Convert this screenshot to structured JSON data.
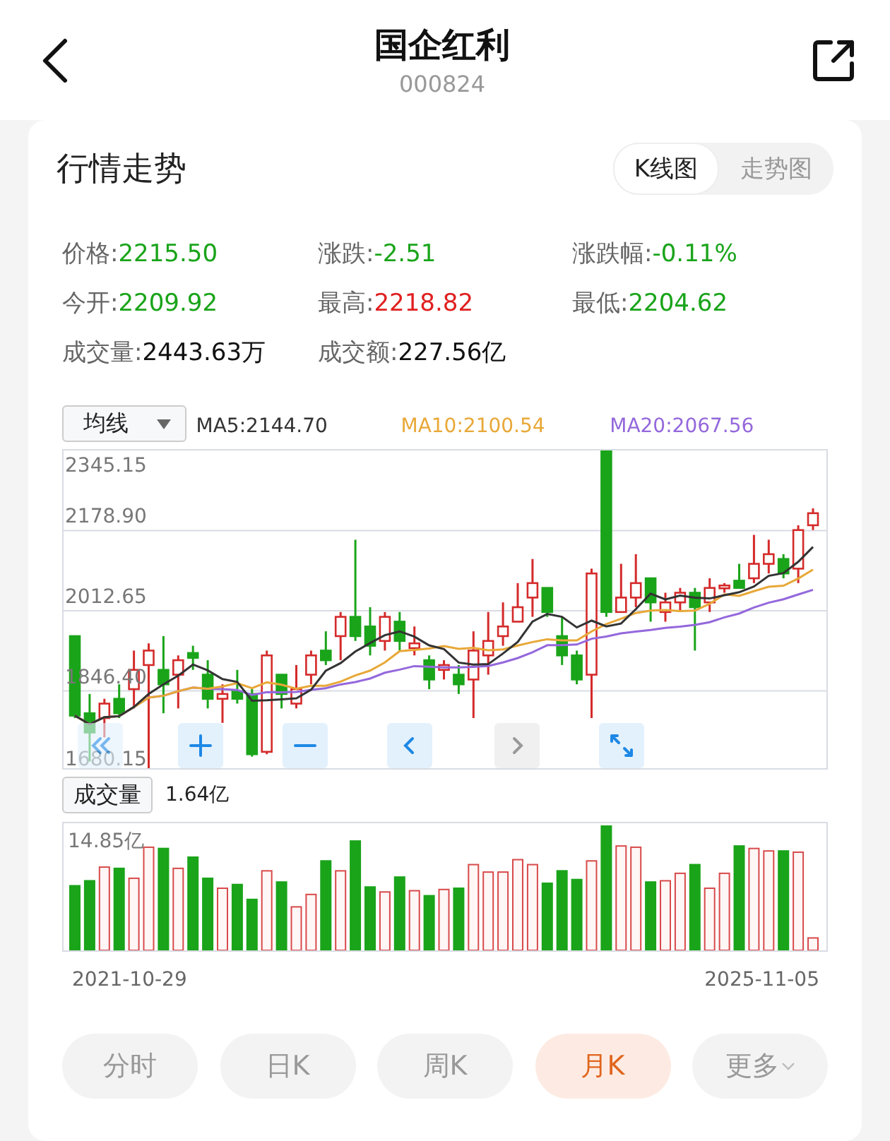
{
  "header": {
    "title": "国企红利",
    "code": "000824"
  },
  "section": {
    "title": "行情走势",
    "view_tabs": [
      {
        "label": "K线图",
        "selected": true
      },
      {
        "label": "走势图",
        "selected": false
      }
    ]
  },
  "stats": [
    {
      "label": "价格:",
      "value": "2215.50",
      "color": "#1aa41a"
    },
    {
      "label": "涨跌:",
      "value": "-2.51",
      "color": "#1aa41a"
    },
    {
      "label": "涨跌幅:",
      "value": "-0.11%",
      "color": "#1aa41a"
    },
    {
      "label": "今开:",
      "value": "2209.92",
      "color": "#1aa41a"
    },
    {
      "label": "最高:",
      "value": "2218.82",
      "color": "#e02020"
    },
    {
      "label": "最低:",
      "value": "2204.62",
      "color": "#1aa41a"
    },
    {
      "label": "成交量:",
      "value": "2443.63万",
      "color": "#111111"
    },
    {
      "label": "成交额:",
      "value": "227.56亿",
      "color": "#111111"
    }
  ],
  "indicator": {
    "selector": "均线",
    "ma": [
      {
        "label": "MA5:2144.70",
        "color": "#333333"
      },
      {
        "label": "MA10:2100.54",
        "color": "#e8a838"
      },
      {
        "label": "MA20:2067.56",
        "color": "#9468dc"
      }
    ]
  },
  "price_chart": {
    "y_labels": [
      "2345.15",
      "2178.90",
      "2012.65",
      "1846.40",
      "1680.15"
    ],
    "controls": [
      {
        "kind": "start",
        "disabled": false
      },
      {
        "kind": "zoom_in",
        "disabled": false
      },
      {
        "kind": "zoom_out",
        "disabled": false
      },
      {
        "kind": "prev",
        "disabled": false
      },
      {
        "kind": "next",
        "disabled": true
      },
      {
        "kind": "fullscreen",
        "disabled": false
      }
    ]
  },
  "volume": {
    "selector": "成交量",
    "reading": "1.64亿",
    "y_label": "14.85亿",
    "start_date": "2021-10-29",
    "end_date": "2025-11-05"
  },
  "periods": [
    {
      "label": "分时",
      "selected": false,
      "dropdown": false
    },
    {
      "label": "日K",
      "selected": false,
      "dropdown": false
    },
    {
      "label": "周K",
      "selected": false,
      "dropdown": false
    },
    {
      "label": "月K",
      "selected": true,
      "dropdown": false
    },
    {
      "label": "更多",
      "selected": false,
      "dropdown": true
    }
  ]
}
